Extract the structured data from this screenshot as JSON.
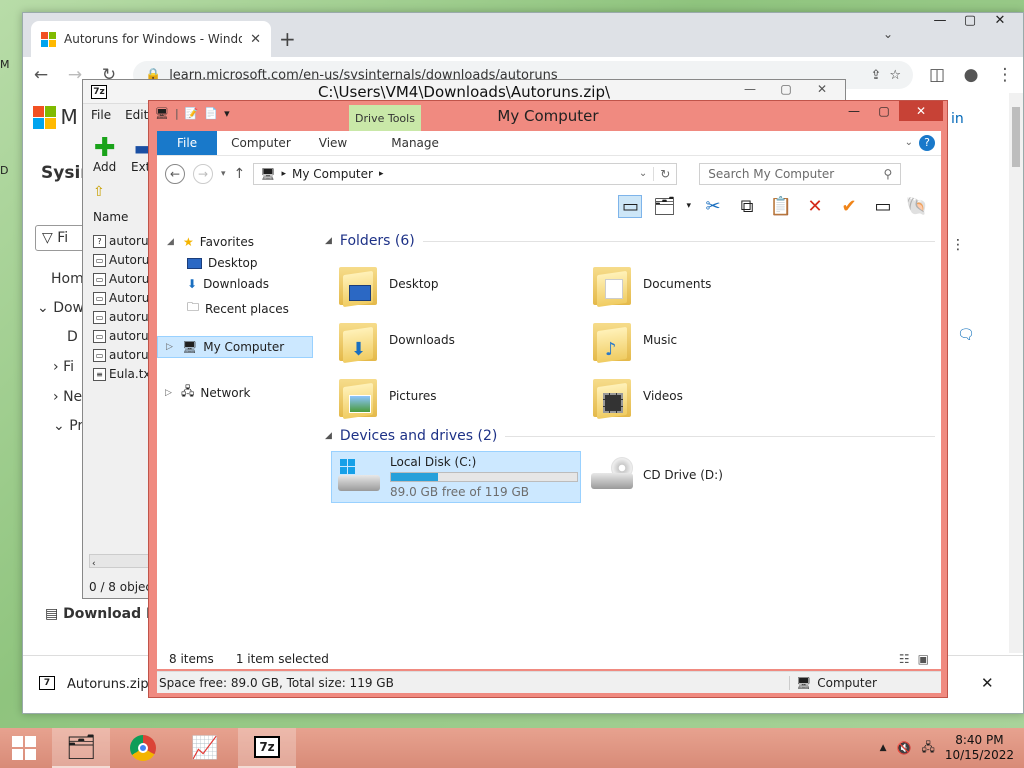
{
  "browser": {
    "tab_title": "Autoruns for Windows - Windows",
    "url": "learn.microsoft.com/en-us/sysinternals/downloads/autoruns",
    "page_fragments": {
      "brand": "M",
      "sysinternals": "Sysir",
      "filter": "Fi",
      "home": "Hom",
      "downloads": "Dow",
      "sub1": "D",
      "file": "Fi",
      "ne": "Ne",
      "pr": "Pr",
      "signin": "in",
      "download_pdf": "Download PD"
    },
    "download_item": "Autoruns.zip"
  },
  "sevenzip": {
    "title": "C:\\Users\\VM4\\Downloads\\Autoruns.zip\\",
    "menu": [
      "File",
      "Edit"
    ],
    "add_label": "Add",
    "extract_label": "Extr",
    "column_name": "Name",
    "files": [
      "autorun",
      "Autorun",
      "Autorun",
      "Autorun",
      "autorun",
      "autorun",
      "autorun",
      "Eula.txt"
    ],
    "status": "0 / 8 object"
  },
  "explorer": {
    "title": "My Computer",
    "contextual_tab": "Drive Tools",
    "ribbon_tabs": [
      "File",
      "Computer",
      "View",
      "Manage"
    ],
    "address_path": "My Computer",
    "search_placeholder": "Search My Computer",
    "nav": {
      "favorites": "Favorites",
      "desktop": "Desktop",
      "downloads": "Downloads",
      "recent": "Recent places",
      "my_computer": "My Computer",
      "network": "Network"
    },
    "folders_header": "Folders (6)",
    "folders": [
      "Desktop",
      "Documents",
      "Downloads",
      "Music",
      "Pictures",
      "Videos"
    ],
    "drives_header": "Devices and drives (2)",
    "local_disk": {
      "name": "Local Disk (C:)",
      "free_text": "89.0 GB free of 119 GB",
      "used_fraction": 0.252
    },
    "cd_drive": "CD Drive (D:)",
    "status_items": "8 items",
    "status_selected": "1 item selected",
    "details_left": "Space free: 89.0 GB, Total size: 119 GB",
    "details_right": "Computer"
  },
  "taskbar": {
    "time": "8:40 PM",
    "date": "10/15/2022"
  }
}
